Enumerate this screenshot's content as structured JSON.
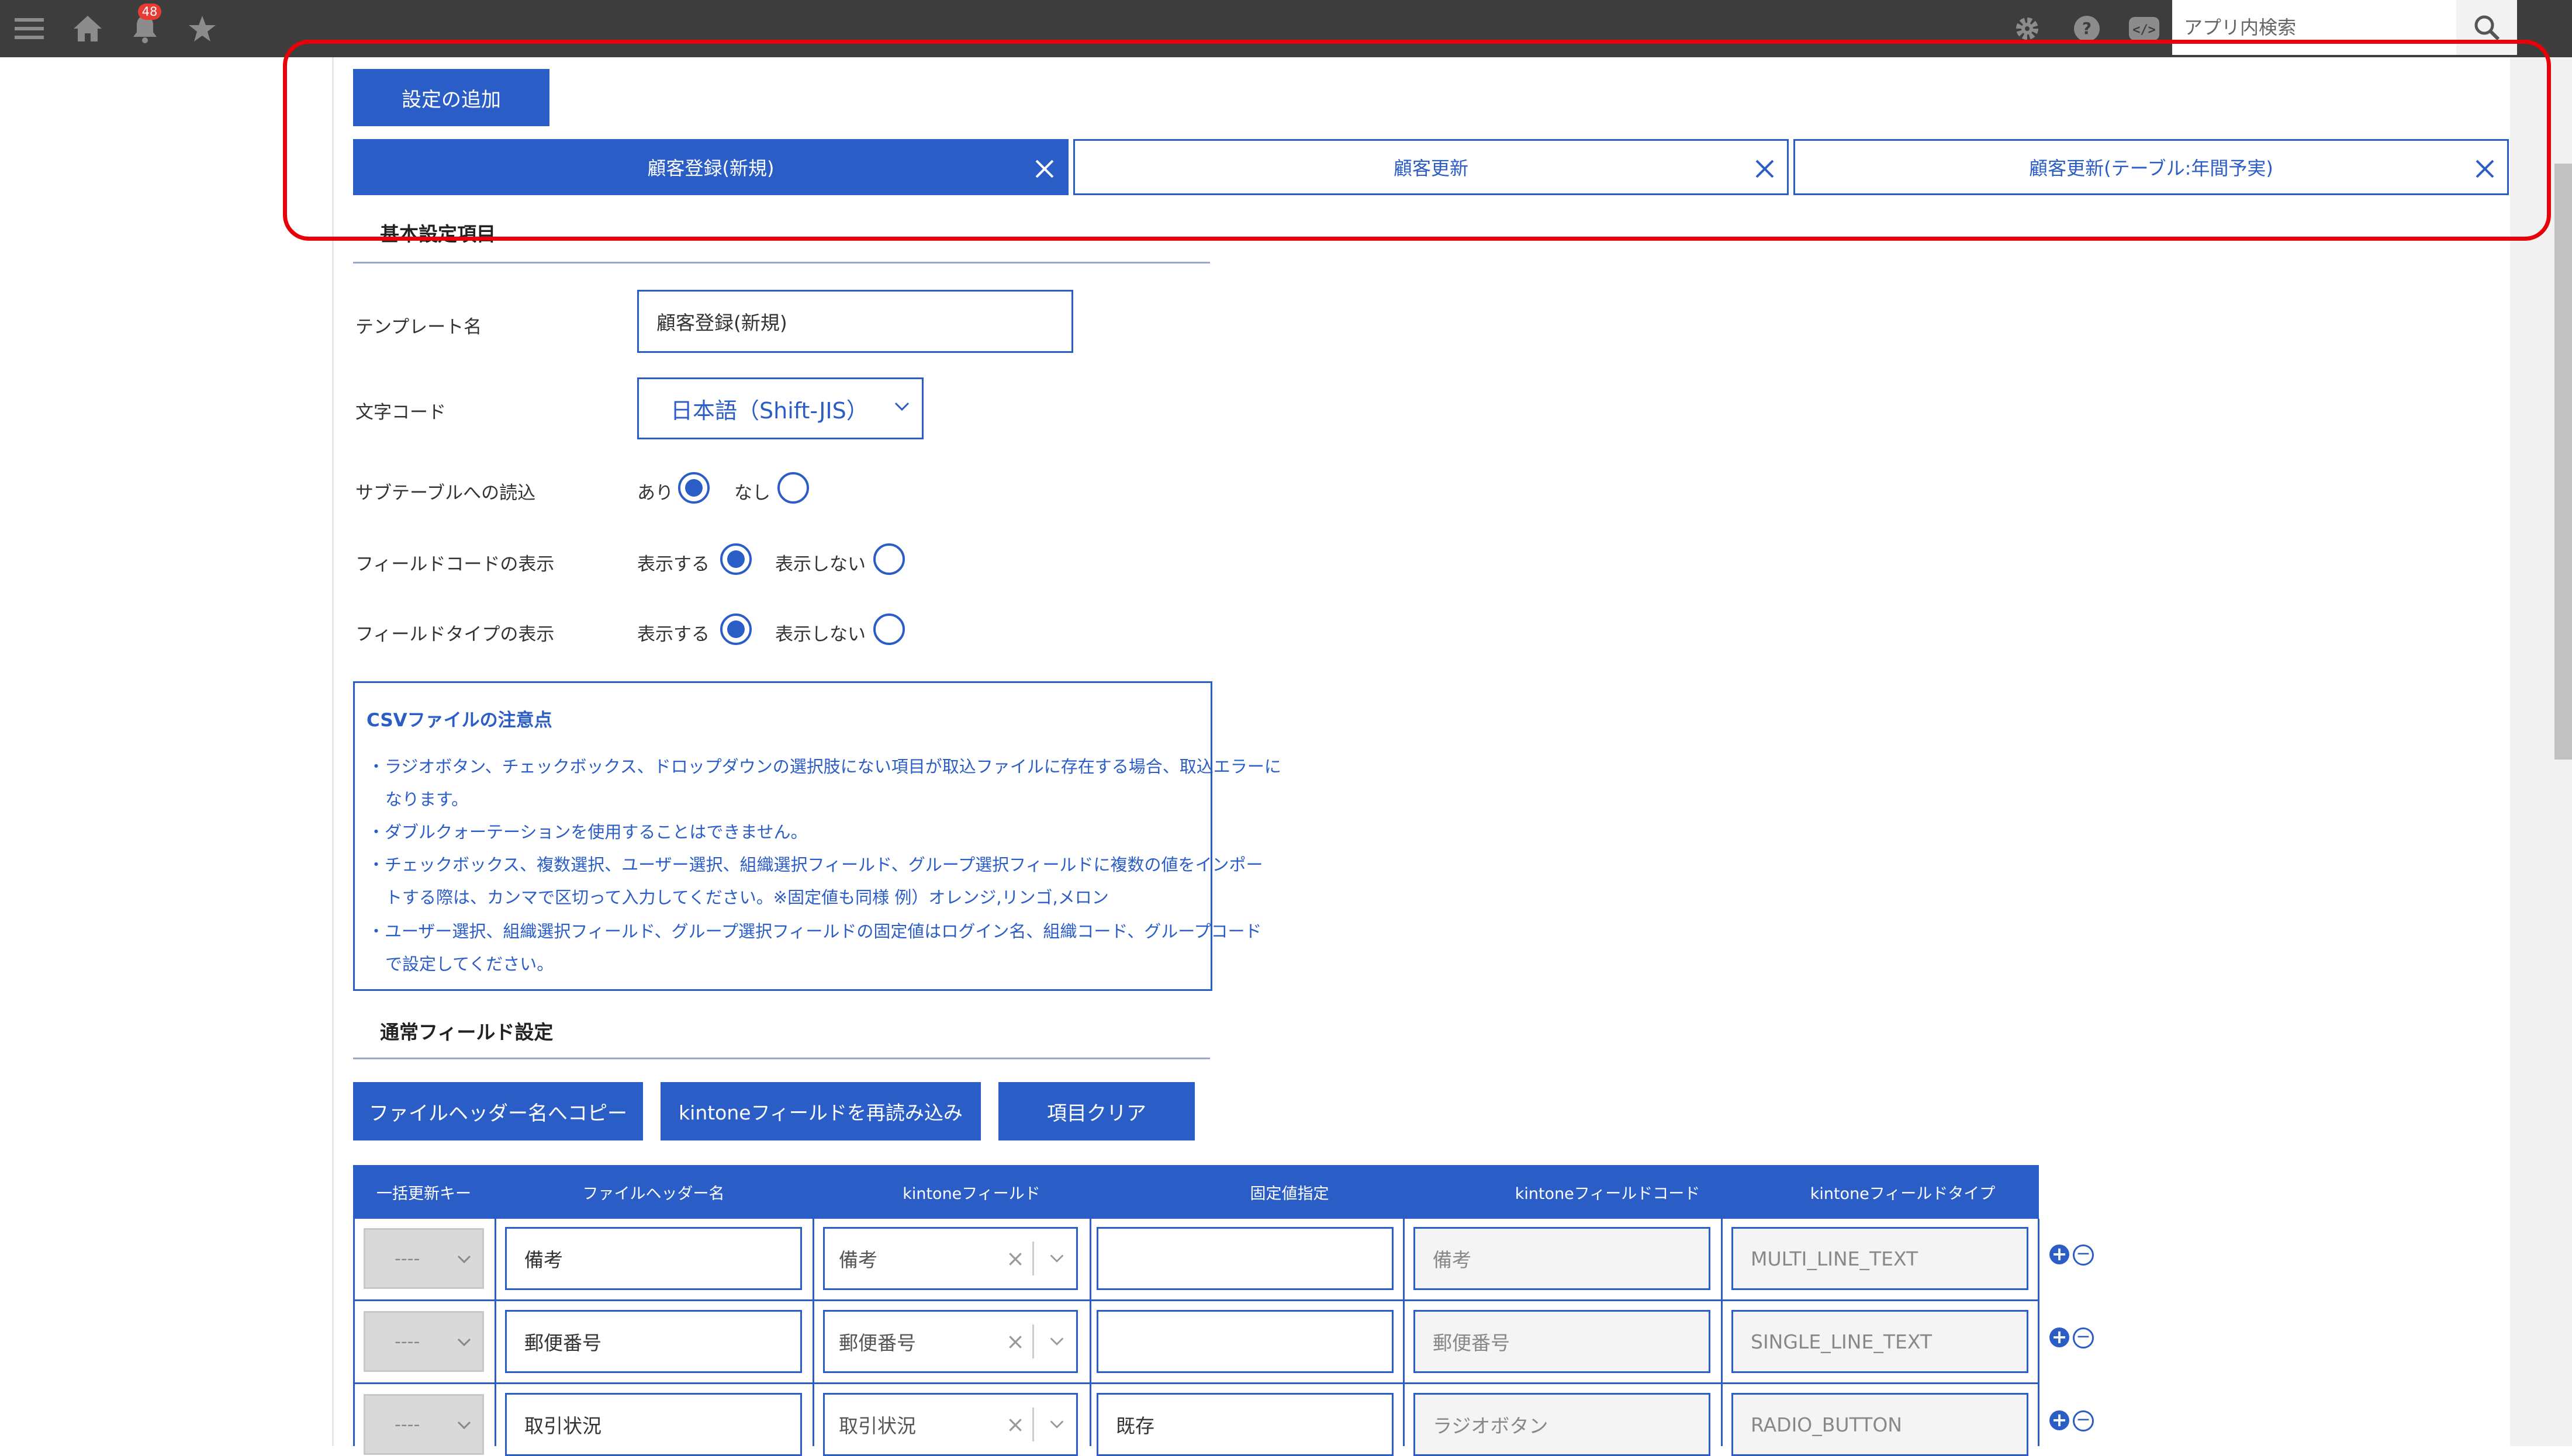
{
  "topbar": {
    "notification_count": "48",
    "search_placeholder": "アプリ内検索"
  },
  "add_setting_button": "設定の追加",
  "tabs": [
    {
      "label": "顧客登録(新規)",
      "active": true
    },
    {
      "label": "顧客更新",
      "active": false
    },
    {
      "label": "顧客更新(テーブル:年間予実)",
      "active": false
    }
  ],
  "basic": {
    "title": "基本設定項目",
    "template_label": "テンプレート名",
    "template_value": "顧客登録(新規)",
    "charset_label": "文字コード",
    "charset_value": "日本語（Shift-JIS）",
    "subtable_label": "サブテーブルへの読込",
    "subtable_yes": "あり",
    "subtable_no": "なし",
    "fieldcode_label": "フィールドコードの表示",
    "fieldtype_label": "フィールドタイプの表示",
    "show": "表示する",
    "hide": "表示しない"
  },
  "notes": {
    "title": "CSVファイルの注意点",
    "lines": [
      "・ラジオボタン、チェックボックス、ドロップダウンの選択肢にない項目が取込ファイルに存在する場合、取込エラーに",
      "なります。",
      "・ダブルクォーテーションを使用することはできません。",
      "・チェックボックス、複数選択、ユーザー選択、組織選択フィールド、グループ選択フィールドに複数の値をインポー",
      "トする際は、カンマで区切って入力してください。※固定値も同様 例）オレンジ,リンゴ,メロン",
      "・ユーザー選択、組織選択フィールド、グループ選択フィールドの固定値はログイン名、組織コード、グループコード",
      "で設定してください。"
    ]
  },
  "normal": {
    "title": "通常フィールド設定",
    "btn_copy": "ファイルヘッダー名へコピー",
    "btn_reload": "kintoneフィールドを再読み込み",
    "btn_clear": "項目クリア"
  },
  "table": {
    "headers": [
      "一括更新キー",
      "ファイルヘッダー名",
      "kintoneフィールド",
      "固定値指定",
      "kintoneフィールドコード",
      "kintoneフィールドタイプ"
    ],
    "key_placeholder": "----",
    "rows": [
      {
        "header": "備考",
        "field": "備考",
        "fixed": "",
        "code": "備考",
        "type": "MULTI_LINE_TEXT"
      },
      {
        "header": "郵便番号",
        "field": "郵便番号",
        "fixed": "",
        "code": "郵便番号",
        "type": "SINGLE_LINE_TEXT"
      },
      {
        "header": "取引状況",
        "field": "取引状況",
        "fixed": "既存",
        "code": "ラジオボタン",
        "type": "RADIO_BUTTON"
      }
    ],
    "combo_clear": "×"
  },
  "colors": {
    "primary": "#2b5dc6",
    "highlight": "#e8000b",
    "topbar": "#3d3d3d"
  }
}
